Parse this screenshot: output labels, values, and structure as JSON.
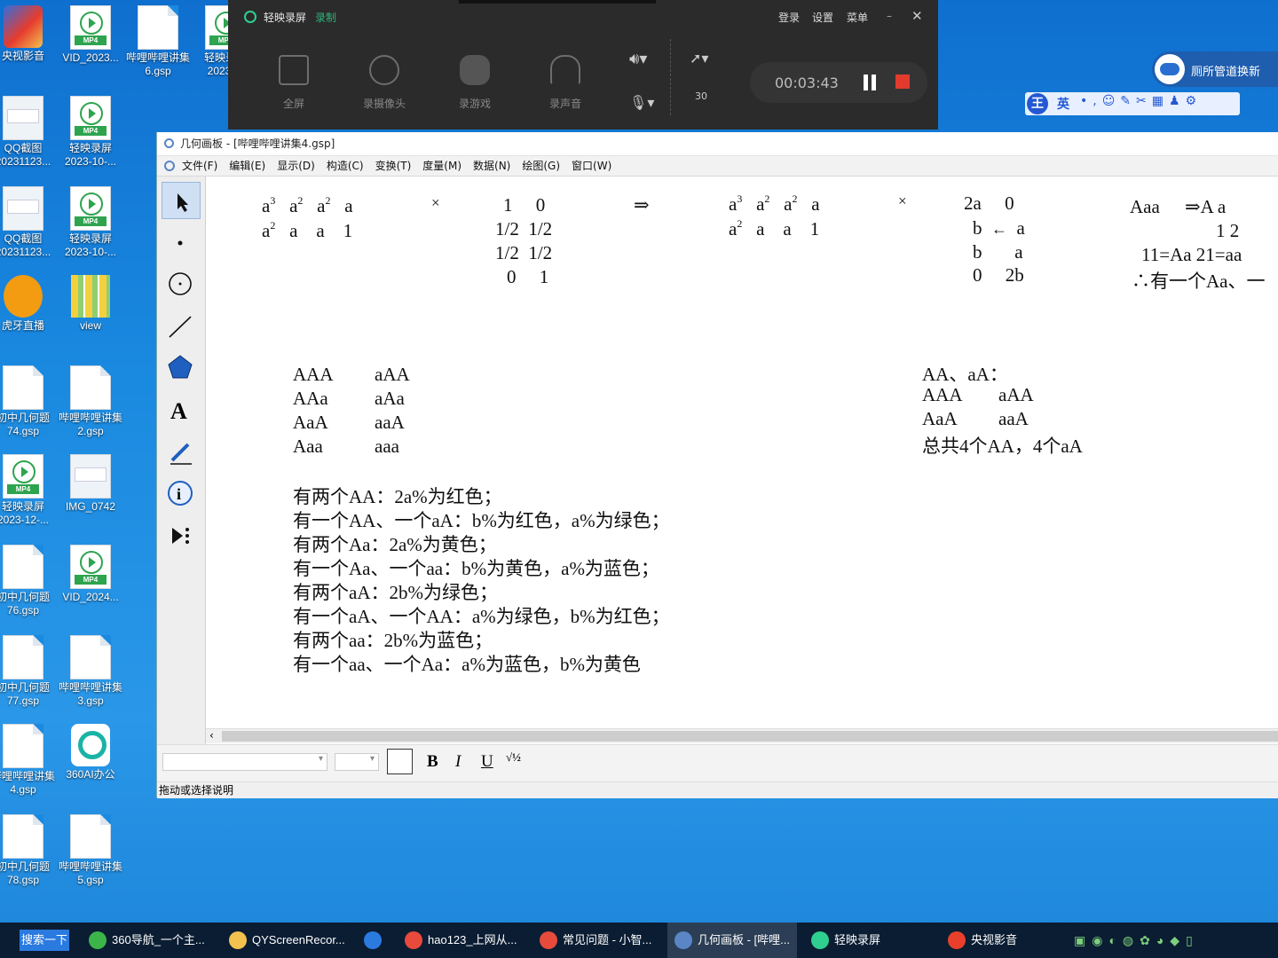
{
  "desktop_icons": [
    {
      "label": "央视影音",
      "kind": "app",
      "col": 0,
      "row": 0
    },
    {
      "label": "VID_2023...",
      "kind": "mp4",
      "col": 1,
      "row": 0
    },
    {
      "label": "哔哩哔哩讲集\n6.gsp",
      "kind": "file",
      "col": 2,
      "row": 0
    },
    {
      "label": "轻映录屏\n2023-...",
      "kind": "mp4",
      "col": 3,
      "row": 0
    },
    {
      "label": "QQ截图\n20231123...",
      "kind": "shot",
      "col": 0,
      "row": 1
    },
    {
      "label": "轻映录屏\n2023-10-...",
      "kind": "mp4",
      "col": 1,
      "row": 1
    },
    {
      "label": "QQ截图\n20231123...",
      "kind": "shot",
      "col": 0,
      "row": 2
    },
    {
      "label": "轻映录屏\n2023-10-...",
      "kind": "mp4",
      "col": 1,
      "row": 2
    },
    {
      "label": "虎牙直播",
      "kind": "huya",
      "col": 0,
      "row": 3
    },
    {
      "label": "view",
      "kind": "view",
      "col": 1,
      "row": 3
    },
    {
      "label": "初中几何题\n74.gsp",
      "kind": "file",
      "col": 0,
      "row": 4
    },
    {
      "label": "哔哩哔哩讲集\n2.gsp",
      "kind": "file",
      "col": 1,
      "row": 4
    },
    {
      "label": "轻映录屏\n2023-12-...",
      "kind": "mp4",
      "col": 0,
      "row": 5
    },
    {
      "label": "IMG_0742",
      "kind": "shot",
      "col": 1,
      "row": 5
    },
    {
      "label": "初中几何题\n76.gsp",
      "kind": "file",
      "col": 0,
      "row": 6
    },
    {
      "label": "VID_2024...",
      "kind": "mp4",
      "col": 1,
      "row": 6
    },
    {
      "label": "初中几何题\n77.gsp",
      "kind": "file",
      "col": 0,
      "row": 7
    },
    {
      "label": "哔哩哔哩讲集\n3.gsp",
      "kind": "file",
      "col": 1,
      "row": 7
    },
    {
      "label": "哔哩哔哩讲集\n4.gsp",
      "kind": "file",
      "col": 0,
      "row": 8
    },
    {
      "label": "360AI办公",
      "kind": "ai",
      "col": 1,
      "row": 8
    },
    {
      "label": "初中几何题\n78.gsp",
      "kind": "file",
      "col": 0,
      "row": 9
    },
    {
      "label": "哔哩哔哩讲集\n5.gsp",
      "kind": "file",
      "col": 1,
      "row": 9
    }
  ],
  "recorder": {
    "title": "轻映录屏",
    "mode": "录制",
    "menu": {
      "login": "登录",
      "settings": "设置",
      "menu": "菜单"
    },
    "tools": [
      {
        "label": "全屏"
      },
      {
        "label": "录摄像头"
      },
      {
        "label": "录游戏"
      },
      {
        "label": "录声音"
      }
    ],
    "fps": "30",
    "time": "00:03:43"
  },
  "widget": {
    "label": "厕所管道换新"
  },
  "ime": {
    "logo": "王",
    "lang": "英"
  },
  "window": {
    "title": "几何画板 - [哔哩哔哩讲集4.gsp]",
    "menus": [
      "文件(F)",
      "编辑(E)",
      "显示(D)",
      "构造(C)",
      "变换(T)",
      "度量(M)",
      "数据(N)",
      "绘图(G)",
      "窗口(W)"
    ],
    "status": "拖动或选择说明",
    "format": {
      "bold": "B",
      "italic": "I",
      "underline": "U"
    }
  },
  "canvas": {
    "times": "×",
    "implies": "⇒",
    "m1_rows": [
      [
        "a",
        "3",
        "a",
        "2",
        "a",
        "2",
        "a"
      ],
      [
        "a",
        "2",
        "a",
        "a",
        "1"
      ]
    ],
    "m2_rows": [
      [
        "1",
        "0"
      ],
      [
        "1/2",
        "1/2"
      ],
      [
        "1/2",
        "1/2"
      ],
      [
        "0",
        "1"
      ]
    ],
    "m3_rows": [
      [
        "2a",
        "0"
      ],
      [
        "b",
        "a"
      ],
      [
        "b",
        "a"
      ],
      [
        "0",
        "2b"
      ]
    ],
    "right_block": [
      "Aaa",
      "⇒A  a",
      "1  2",
      "11=Aa   21=aa",
      "∴有一个Aa、一"
    ],
    "combo_left": [
      "AAA",
      "AAa",
      "AaA",
      "Aaa"
    ],
    "combo_right": [
      "aAA",
      "aAa",
      "aaA",
      "aaa"
    ],
    "aa_block": [
      "AA、aA：",
      "AAA",
      "aAA",
      "AaA",
      "aaA",
      "总共4个AA，4个aA"
    ],
    "rules": [
      "有两个AA：2a%为红色；",
      "有一个AA、一个aA：b%为红色，a%为绿色；",
      "有两个Aa：2a%为黄色；",
      "有一个Aa、一个aa：b%为黄色，a%为蓝色；",
      "有两个aA：2b%为绿色；",
      "有一个aA、一个AA：a%为绿色，b%为红色；",
      "有两个aa：2b%为蓝色；",
      "有一个aa、一个Aa：a%为蓝色，b%为黄色"
    ]
  },
  "taskbar": {
    "search": "搜索一下",
    "items": [
      {
        "label": "360导航_一个主...",
        "color": "#3cb44a"
      },
      {
        "label": "QYScreenRecor...",
        "color": "#f2c14e"
      },
      {
        "label": "",
        "color": "#2a7ae0"
      },
      {
        "label": "hao123_上网从...",
        "color": "#e84a3c"
      },
      {
        "label": "常见问题 - 小智...",
        "color": "#e84a3c"
      },
      {
        "label": "几何画板 - [哔哩...",
        "color": "#5a86c6"
      },
      {
        "label": "轻映录屏",
        "color": "#2fcf8f"
      },
      {
        "label": "央视影音",
        "color": "#e8402a"
      }
    ]
  }
}
